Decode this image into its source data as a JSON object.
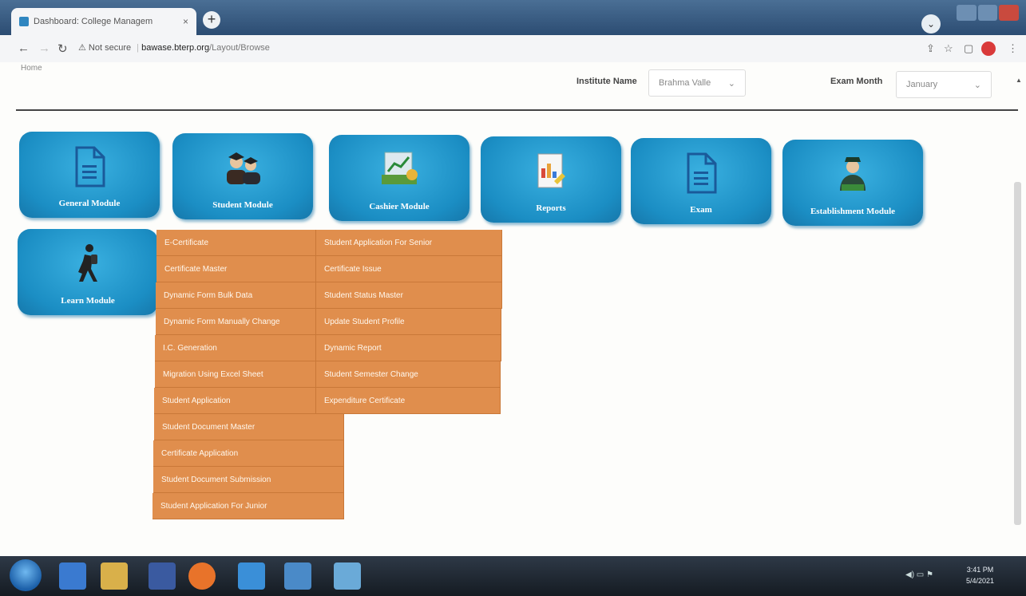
{
  "browser": {
    "tab_title": "Dashboard: College Managem",
    "tab_close": "×",
    "new_tab": "+",
    "url_warning": "⚠ Not secure",
    "url_host": "bawase.bterp.org",
    "url_path": "/Layout/Browse",
    "breadcrumb": "Home"
  },
  "header": {
    "institute_label": "Institute Name",
    "institute_value": "Brahma Valle",
    "exam_month_label": "Exam Month",
    "exam_month_value": "January"
  },
  "modules": [
    {
      "label": "General Module",
      "icon": "document-icon"
    },
    {
      "label": "Student Module",
      "icon": "students-icon"
    },
    {
      "label": "Cashier Module",
      "icon": "cashier-icon"
    },
    {
      "label": "Reports",
      "icon": "report-icon"
    },
    {
      "label": "Exam",
      "icon": "document-icon"
    },
    {
      "label": "Establishment Module",
      "icon": "officer-icon"
    },
    {
      "label": "Learn Module",
      "icon": "hiker-icon"
    }
  ],
  "student_menu": {
    "left": [
      "E-Certificate",
      "Certificate Master",
      "Dynamic Form Bulk Data",
      "Dynamic Form Manually Change",
      "I.C. Generation",
      "Migration Using Excel Sheet",
      "Student Application",
      "Student Document Master",
      "Certificate Application",
      "Student Document Submission",
      "Student Application For Junior"
    ],
    "right": [
      "Student Application For Senior",
      "Certificate Issue",
      "Student Status Master",
      "Update Student Profile",
      "Dynamic Report",
      "Student Semester Change",
      "Expenditure Certificate"
    ]
  },
  "taskbar": {
    "tray": "◀) ▭ ⚑",
    "time": "3:41 PM",
    "date": "5/4/2021"
  },
  "colors": {
    "module_blue": "#1b8ec4",
    "menu_orange": "#e08e4d"
  }
}
